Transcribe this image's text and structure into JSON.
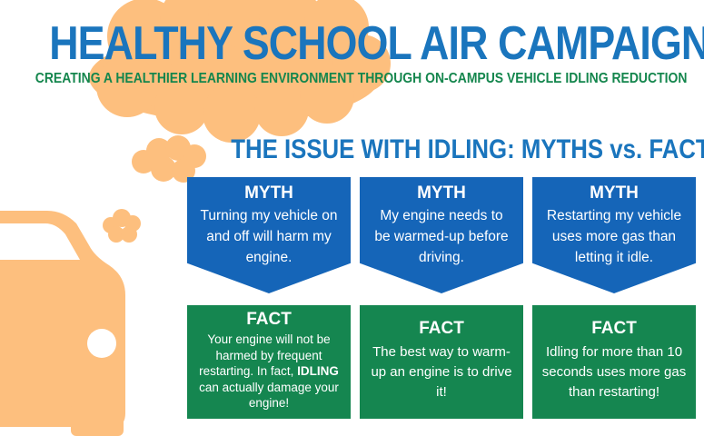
{
  "header": {
    "title": "HEALTHY SCHOOL AIR CAMPAIGN",
    "subtitle": "CREATING A HEALTHIER LEARNING ENVIRONMENT THROUGH ON-CAMPUS VEHICLE IDLING REDUCTION"
  },
  "section_title": "THE ISSUE WITH IDLING:  MYTHS vs. FACTS",
  "myths": [
    {
      "heading": "MYTH",
      "text": "Turning my vehicle on and off will harm my engine."
    },
    {
      "heading": "MYTH",
      "text": "My engine needs to be warmed-up before driving."
    },
    {
      "heading": "MYTH",
      "text": "Restarting my vehicle uses more gas than letting it idle."
    }
  ],
  "facts": [
    {
      "heading": "FACT",
      "text_before": "Your engine will not be harmed by frequent restarting.  In fact, ",
      "emphasis": "IDLING",
      "text_after": " can actually damage your engine!"
    },
    {
      "heading": "FACT",
      "text": "The best way to warm-up an engine is to drive it!"
    },
    {
      "heading": "FACT",
      "text": "Idling for more than 10 seconds uses more gas than restarting!"
    }
  ],
  "colors": {
    "title_blue": "#1a75bd",
    "subtitle_green": "#14864d",
    "myth_blue": "#1565b8",
    "fact_green": "#158650",
    "smoke_orange": "#fdbf7e"
  },
  "icons": [
    "car-icon",
    "exhaust-cloud-icon"
  ]
}
